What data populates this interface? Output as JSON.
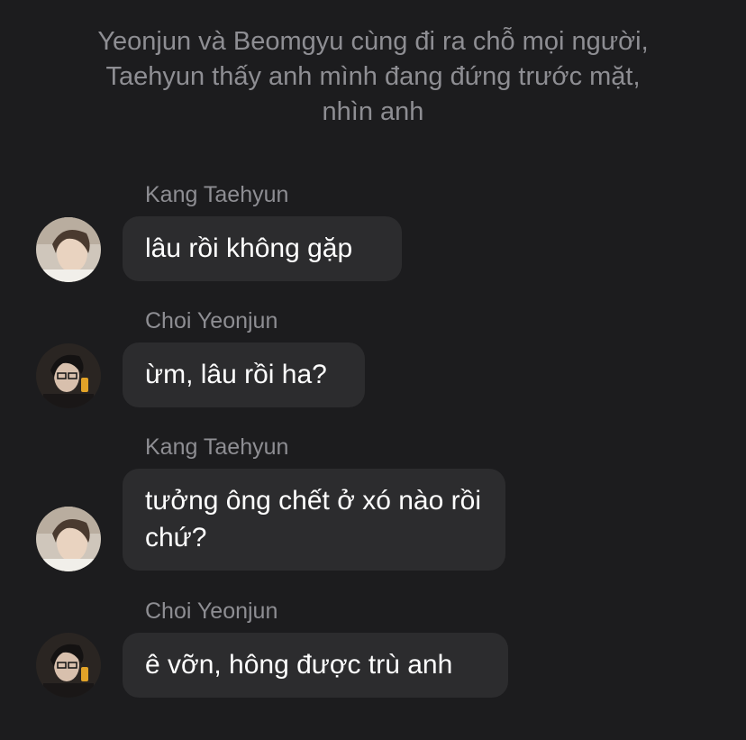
{
  "narration": "Yeonjun và Beomgyu cùng đi ra chỗ mọi người, Taehyun thấy anh mình đang đứng trước mặt, nhìn anh",
  "messages": [
    {
      "sender": "Kang Taehyun",
      "text": "lâu rồi không gặp",
      "avatar": "taehyun-avatar"
    },
    {
      "sender": "Choi Yeonjun",
      "text": "ừm, lâu rồi ha?",
      "avatar": "yeonjun-avatar"
    },
    {
      "sender": "Kang Taehyun",
      "text": "tưởng ông chết ở xó nào rồi chứ?",
      "avatar": "taehyun-avatar"
    },
    {
      "sender": "Choi Yeonjun",
      "text": "ê vỡn, hông được trù anh",
      "avatar": "yeonjun-avatar"
    }
  ],
  "colors": {
    "background": "#1c1c1e",
    "bubble": "#2c2c2e",
    "secondary_text": "#8e8e93",
    "primary_text": "#ffffff"
  }
}
